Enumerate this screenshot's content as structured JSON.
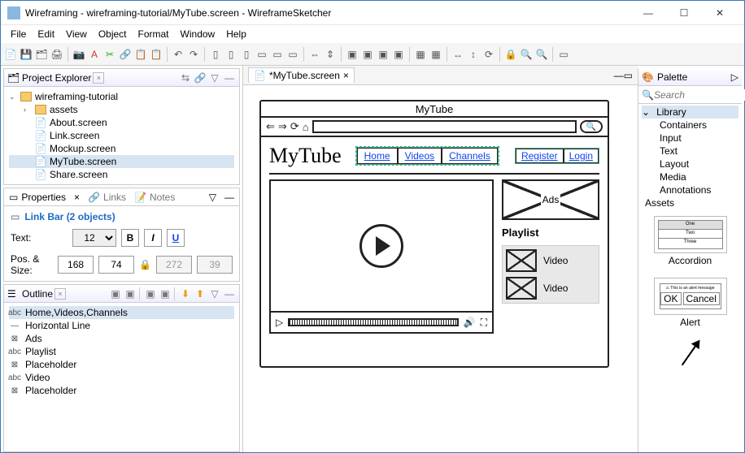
{
  "window": {
    "title": "Wireframing - wireframing-tutorial/MyTube.screen - WireframeSketcher"
  },
  "menu": [
    "File",
    "Edit",
    "View",
    "Object",
    "Format",
    "Window",
    "Help"
  ],
  "explorer": {
    "title": "Project Explorer",
    "root": "wireframing-tutorial",
    "folder": "assets",
    "files": [
      "About.screen",
      "Link.screen",
      "Mockup.screen",
      "MyTube.screen",
      "Share.screen"
    ]
  },
  "props": {
    "tabs": {
      "properties": "Properties",
      "links": "Links",
      "notes": "Notes"
    },
    "selection": "Link Bar (2 objects)",
    "text_label": "Text:",
    "font_size": "12",
    "pos_label": "Pos. & Size:",
    "x": "168",
    "y": "74",
    "w": "272",
    "h": "39"
  },
  "outline": {
    "title": "Outline",
    "items": [
      {
        "icon": "abc",
        "label": "Home,Videos,Channels",
        "sel": true
      },
      {
        "icon": "—",
        "label": "Horizontal Line"
      },
      {
        "icon": "⊠",
        "label": "Ads"
      },
      {
        "icon": "abc",
        "label": "Playlist"
      },
      {
        "icon": "⊠",
        "label": "Placeholder"
      },
      {
        "icon": "abc",
        "label": "Video"
      },
      {
        "icon": "⊠",
        "label": "Placeholder"
      }
    ]
  },
  "editor": {
    "tab": "*MyTube.screen"
  },
  "wireframe": {
    "browser_title": "MyTube",
    "logo": "MyTube",
    "nav": [
      "Home",
      "Videos",
      "Channels"
    ],
    "auth": [
      "Register",
      "Login"
    ],
    "ads": "Ads",
    "playlist_title": "Playlist",
    "video_label": "Video"
  },
  "palette": {
    "title": "Palette",
    "search_placeholder": "Search",
    "library": "Library",
    "cats": [
      "Containers",
      "Input",
      "Text",
      "Layout",
      "Media",
      "Annotations"
    ],
    "assets": "Assets",
    "items": [
      "Accordion",
      "Alert"
    ]
  }
}
